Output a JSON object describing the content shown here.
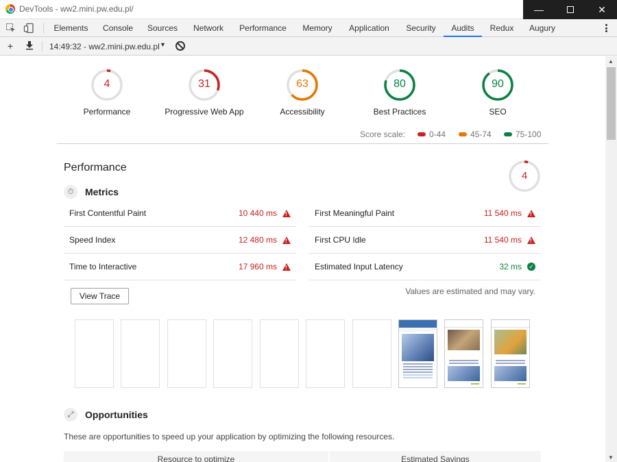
{
  "window": {
    "title": "DevTools - ww2.mini.pw.edu.pl/"
  },
  "tabs": [
    "Elements",
    "Console",
    "Sources",
    "Network",
    "Performance",
    "Memory",
    "Application",
    "Security",
    "Audits",
    "Redux",
    "Augury"
  ],
  "active_tab": "Audits",
  "audit_toolbar": {
    "report": "14:49:32 - ww2.mini.pw.edu.pl"
  },
  "scores": [
    {
      "label": "Performance",
      "value": "4",
      "color": "#c7221f",
      "fraction": 0.04
    },
    {
      "label": "Progressive Web App",
      "value": "31",
      "color": "#c7221f",
      "fraction": 0.31
    },
    {
      "label": "Accessibility",
      "value": "63",
      "color": "#e67700",
      "fraction": 0.63
    },
    {
      "label": "Best Practices",
      "value": "80",
      "color": "#0b8043",
      "fraction": 0.8
    },
    {
      "label": "SEO",
      "value": "90",
      "color": "#0b8043",
      "fraction": 0.9
    }
  ],
  "score_scale": {
    "label": "Score scale:",
    "ranges": [
      {
        "text": "0-44",
        "color": "#c7221f"
      },
      {
        "text": "45-74",
        "color": "#e67700"
      },
      {
        "text": "75-100",
        "color": "#0b8043"
      }
    ]
  },
  "performance": {
    "title": "Performance",
    "score": "4",
    "metrics_title": "Metrics",
    "metrics": [
      {
        "name": "First Contentful Paint",
        "value": "10 440 ms",
        "status": "fail"
      },
      {
        "name": "First Meaningful Paint",
        "value": "11 540 ms",
        "status": "fail"
      },
      {
        "name": "Speed Index",
        "value": "12 480 ms",
        "status": "fail"
      },
      {
        "name": "First CPU Idle",
        "value": "11 540 ms",
        "status": "fail"
      },
      {
        "name": "Time to Interactive",
        "value": "17 960 ms",
        "status": "fail"
      },
      {
        "name": "Estimated Input Latency",
        "value": "32 ms",
        "status": "pass"
      }
    ],
    "view_trace": "View Trace",
    "note": "Values are estimated and may vary."
  },
  "opportunities": {
    "title": "Opportunities",
    "description": "These are opportunities to speed up your application by optimizing the following resources.",
    "columns": [
      "Resource to optimize",
      "Estimated Savings"
    ]
  }
}
